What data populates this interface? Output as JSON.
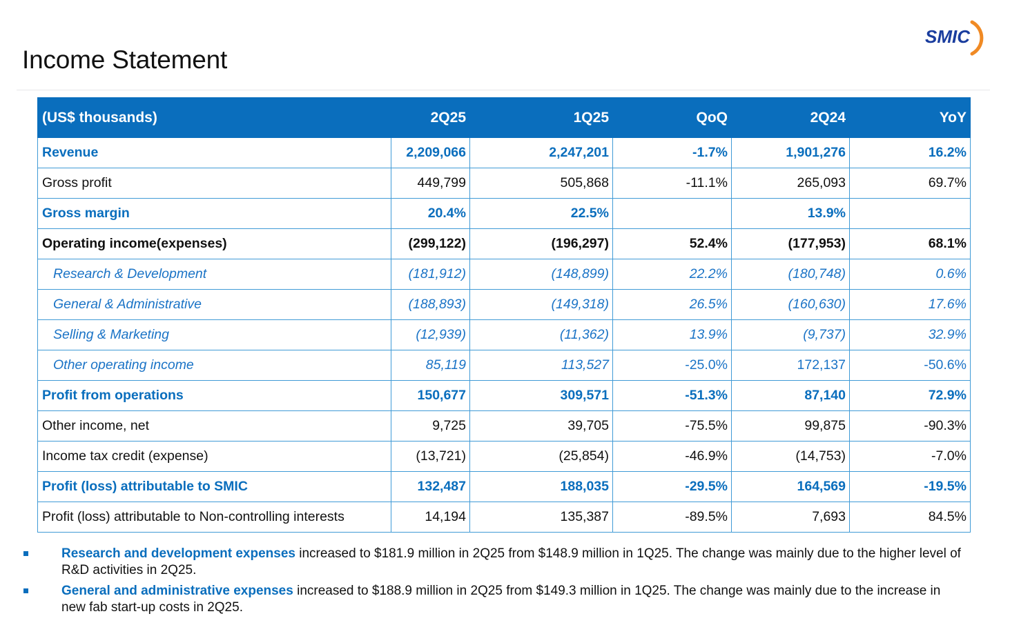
{
  "page": {
    "title": "Income Statement"
  },
  "logo": {
    "text": "SMIC"
  },
  "table": {
    "headers": [
      "(US$ thousands)",
      "2Q25",
      "1Q25",
      "QoQ",
      "2Q24",
      "YoY"
    ],
    "rows": [
      {
        "style": "blue",
        "cells": [
          "Revenue",
          "2,209,066",
          "2,247,201",
          "-1.7%",
          "1,901,276",
          "16.2%"
        ]
      },
      {
        "style": "normal",
        "cells": [
          "Gross profit",
          "449,799",
          "505,868",
          "-11.1%",
          "265,093",
          "69.7%"
        ]
      },
      {
        "style": "blue",
        "cells": [
          "Gross margin",
          "20.4%",
          "22.5%",
          "",
          "13.9%",
          ""
        ]
      },
      {
        "style": "bold",
        "cells": [
          "Operating income(expenses)",
          "(299,122)",
          "(196,297)",
          "52.4%",
          "(177,953)",
          "68.1%"
        ]
      },
      {
        "style": "italic",
        "cells": [
          "Research & Development",
          "(181,912)",
          "(148,899)",
          "22.2%",
          "(180,748)",
          "0.6%"
        ]
      },
      {
        "style": "italic",
        "cells": [
          "General & Administrative",
          "(188,893)",
          "(149,318)",
          "26.5%",
          "(160,630)",
          "17.6%"
        ]
      },
      {
        "style": "italic",
        "cells": [
          "Selling & Marketing",
          "(12,939)",
          "(11,362)",
          "13.9%",
          "(9,737)",
          "32.9%"
        ]
      },
      {
        "style": "blueplain",
        "cells": [
          "Other operating income",
          "85,119",
          "113,527",
          "-25.0%",
          "172,137",
          "-50.6%"
        ]
      },
      {
        "style": "blue",
        "cells": [
          "Profit from operations",
          "150,677",
          "309,571",
          "-51.3%",
          "87,140",
          "72.9%"
        ]
      },
      {
        "style": "normal",
        "cells": [
          "Other income, net",
          "9,725",
          "39,705",
          "-75.5%",
          "99,875",
          "-90.3%"
        ]
      },
      {
        "style": "normal",
        "cells": [
          "Income tax credit (expense)",
          "(13,721)",
          "(25,854)",
          "-46.9%",
          "(14,753)",
          "-7.0%"
        ]
      },
      {
        "style": "blue",
        "cells": [
          "Profit (loss) attributable to SMIC",
          "132,487",
          "188,035",
          "-29.5%",
          "164,569",
          "-19.5%"
        ]
      },
      {
        "style": "normal",
        "cells": [
          "Profit (loss) attributable to Non-controlling interests",
          "14,194",
          "135,387",
          "-89.5%",
          "7,693",
          "84.5%"
        ]
      }
    ]
  },
  "notes": [
    {
      "lead": "Research and development expenses",
      "text": " increased to $181.9 million in 2Q25 from $148.9 million in 1Q25. The change was mainly due to the higher level of R&D activities in 2Q25."
    },
    {
      "lead": "General and administrative expenses",
      "text": " increased to $188.9 million in 2Q25 from $149.3 million in 1Q25. The change was mainly due to the increase in new fab start-up costs in 2Q25."
    }
  ],
  "colors": {
    "accent": "#0a6ebd",
    "border": "#3f9ad6",
    "logo_orange": "#f08a24"
  }
}
